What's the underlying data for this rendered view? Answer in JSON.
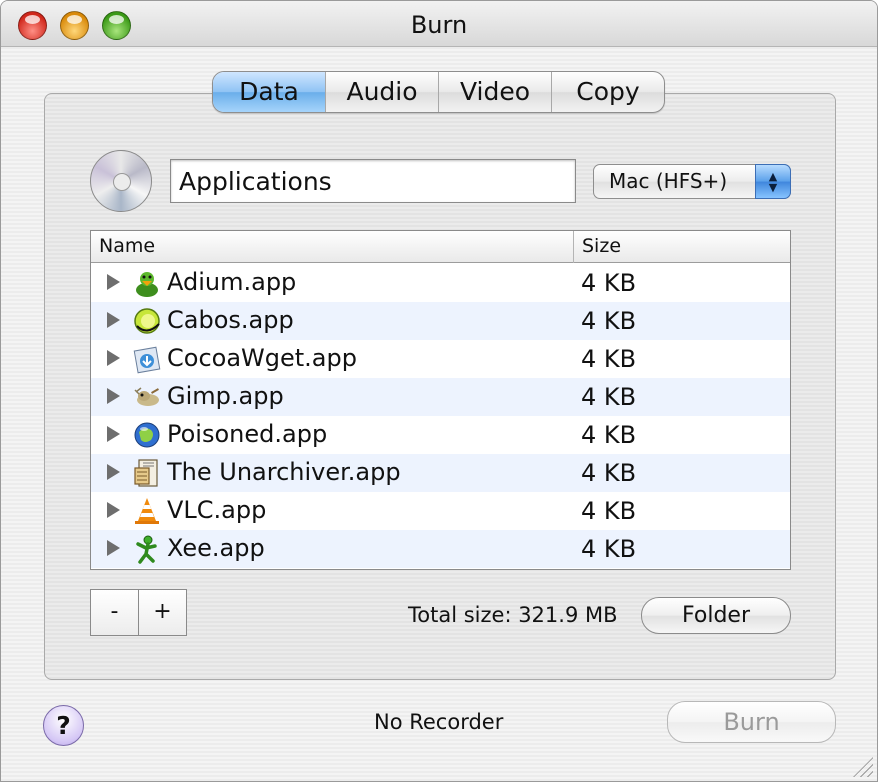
{
  "window": {
    "title": "Burn"
  },
  "tabs": [
    {
      "label": "Data",
      "active": true
    },
    {
      "label": "Audio",
      "active": false
    },
    {
      "label": "Video",
      "active": false
    },
    {
      "label": "Copy",
      "active": false
    }
  ],
  "disc": {
    "name_value": "Applications",
    "format_selected": "Mac (HFS+)"
  },
  "table": {
    "columns": [
      "Name",
      "Size"
    ],
    "rows": [
      {
        "name": "Adium.app",
        "size": "4 KB",
        "icon": "adium-duck-icon"
      },
      {
        "name": "Cabos.app",
        "size": "4 KB",
        "icon": "cabos-lime-icon"
      },
      {
        "name": "CocoaWget.app",
        "size": "4 KB",
        "icon": "cocoawget-download-icon"
      },
      {
        "name": "Gimp.app",
        "size": "4 KB",
        "icon": "gimp-wilber-icon"
      },
      {
        "name": "Poisoned.app",
        "size": "4 KB",
        "icon": "poisoned-globe-icon"
      },
      {
        "name": "The Unarchiver.app",
        "size": "4 KB",
        "icon": "unarchiver-archive-icon"
      },
      {
        "name": "VLC.app",
        "size": "4 KB",
        "icon": "vlc-cone-icon"
      },
      {
        "name": "Xee.app",
        "size": "4 KB",
        "icon": "xee-figure-icon"
      }
    ]
  },
  "controls": {
    "remove_label": "-",
    "add_label": "+",
    "total_size": "Total size: 321.9 MB",
    "folder_label": "Folder"
  },
  "footer": {
    "help_label": "?",
    "status": "No Recorder",
    "burn_label": "Burn",
    "burn_enabled": false
  },
  "colors": {
    "active_tab": "#8fc3f4",
    "row_alt": "#edf3fe"
  }
}
